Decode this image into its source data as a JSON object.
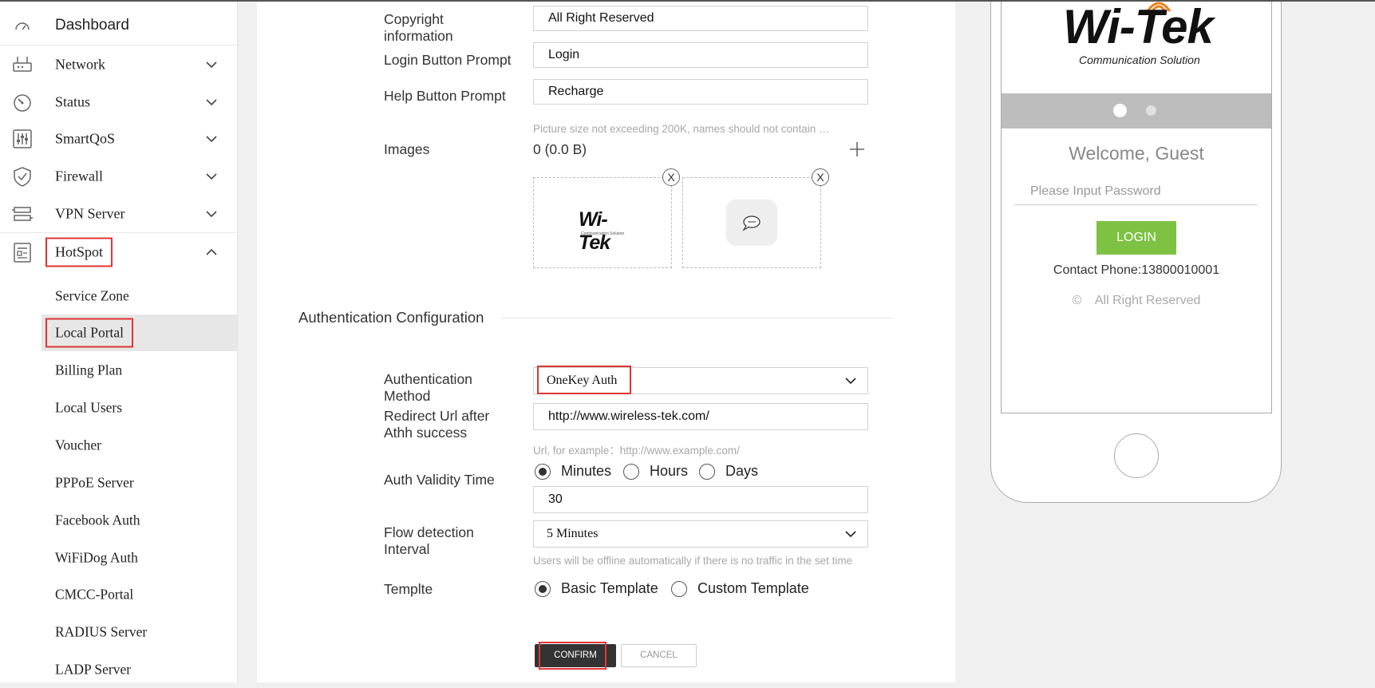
{
  "sidebar": {
    "dashboard": "Dashboard",
    "items": [
      {
        "label": "Network"
      },
      {
        "label": "Status"
      },
      {
        "label": "SmartQoS"
      },
      {
        "label": "Firewall"
      },
      {
        "label": "VPN Server"
      },
      {
        "label": "HotSpot"
      }
    ],
    "sub_items": [
      {
        "label": "Service Zone"
      },
      {
        "label": "Local Portal"
      },
      {
        "label": "Billing Plan"
      },
      {
        "label": "Local Users"
      },
      {
        "label": "Voucher"
      },
      {
        "label": "PPPoE Server"
      },
      {
        "label": "Facebook Auth"
      },
      {
        "label": "WiFiDog Auth"
      },
      {
        "label": "CMCC-Portal"
      },
      {
        "label": "RADIUS Server"
      },
      {
        "label": "LADP Server"
      }
    ]
  },
  "form": {
    "copyright_label": "Copyright information",
    "copyright_value": "All Right Reserved",
    "login_prompt_label": "Login Button Prompt",
    "login_prompt_value": "Login",
    "help_prompt_label": "Help Button Prompt",
    "help_prompt_value": "Recharge",
    "images_hint": "Picture size not exceeding 200K, names should not contain …",
    "images_label": "Images",
    "images_size": "0 (0.0 B)",
    "image_remove": "X",
    "logo_text": "Wi-Tek",
    "logo_subtext": "Communication Solution"
  },
  "auth": {
    "section_title": "Authentication Configuration",
    "method_label": "Authentication Method",
    "method_value": "OneKey Auth",
    "redirect_label": "Redirect Url after Athh success",
    "redirect_value": "http://www.wireless-tek.com/",
    "redirect_hint": "Url, for example：http://www.example.com/",
    "validity_label": "Auth Validity Time",
    "validity_options": [
      "Minutes",
      "Hours",
      "Days"
    ],
    "validity_selected": "Minutes",
    "validity_value": "30",
    "flow_label": "Flow detection Interval",
    "flow_value": "5 Minutes",
    "flow_hint": "Users will be offline automatically if there is no traffic in the set time",
    "template_label": "Templte",
    "template_options": [
      "Basic Template",
      "Custom Template"
    ],
    "template_selected": "Basic Template"
  },
  "buttons": {
    "confirm": "CONFIRM",
    "cancel": "CANCEL"
  },
  "preview": {
    "logo_text": "Wi-Tek",
    "logo_subtext": "Communication Solution",
    "welcome": "Welcome, Guest",
    "password_placeholder": "Please Input Password",
    "login": "LOGIN",
    "contact": "Contact Phone:13800010001",
    "rights_symbol": "©",
    "rights": "All Right Reserved"
  },
  "colors": {
    "accent_red": "#e03535",
    "login_green": "#7dc242",
    "confirm_dark": "#333333",
    "logo_orange": "#e8821e"
  }
}
